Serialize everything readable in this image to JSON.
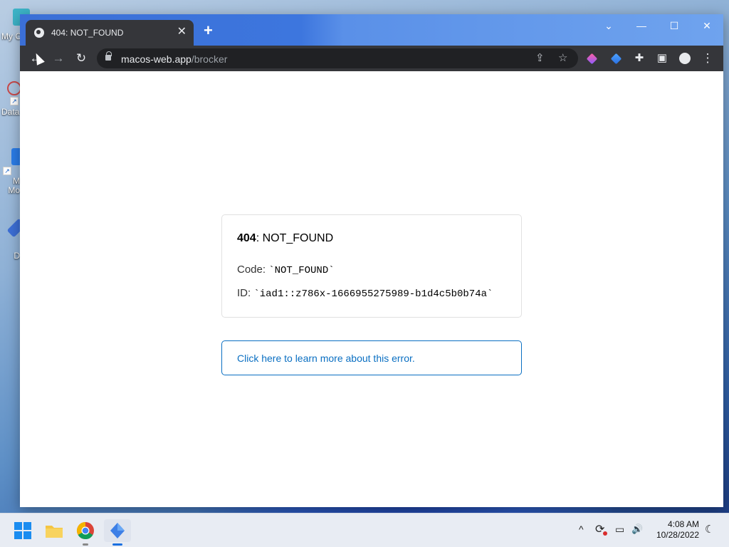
{
  "desktop": {
    "icons": [
      {
        "label": "My C"
      },
      {
        "label": "Data"
      },
      {
        "label": "M\nMo"
      },
      {
        "label": "D"
      }
    ]
  },
  "browser": {
    "tab": {
      "title": "404: NOT_FOUND",
      "close": "✕"
    },
    "new_tab": "+",
    "window_controls": {
      "dropdown": "⌄",
      "minimize": "—",
      "maximize": "☐",
      "close": "✕"
    },
    "nav": {
      "back": "←",
      "forward": "→",
      "reload": "↻"
    },
    "address": {
      "host": "macos-web.app",
      "path": "/brocker"
    },
    "omnibox_actions": {
      "share": "⇪",
      "bookmark": "☆"
    },
    "toolbar_icons": {
      "extensions": "✚",
      "sidepanel": "▣",
      "menu": "⋮"
    },
    "colors": {
      "titlebar": "#3b6fd6",
      "tab": "#35363a",
      "link": "#0a6fc2"
    }
  },
  "error_page": {
    "status_code": "404",
    "status_text": ": NOT_FOUND",
    "code_label": "Code: ",
    "code_value": "`NOT_FOUND`",
    "id_label": "ID: ",
    "id_value": "`iad1::z786x-1666955275989-b1d4c5b0b74a`",
    "learn_more": "Click here to learn more about this error."
  },
  "taskbar": {
    "tray": {
      "chevron": "^",
      "sync": "⟳",
      "network": "▭",
      "volume": "🔊",
      "moon": "☾"
    },
    "time": "4:08 AM",
    "date": "10/28/2022"
  }
}
